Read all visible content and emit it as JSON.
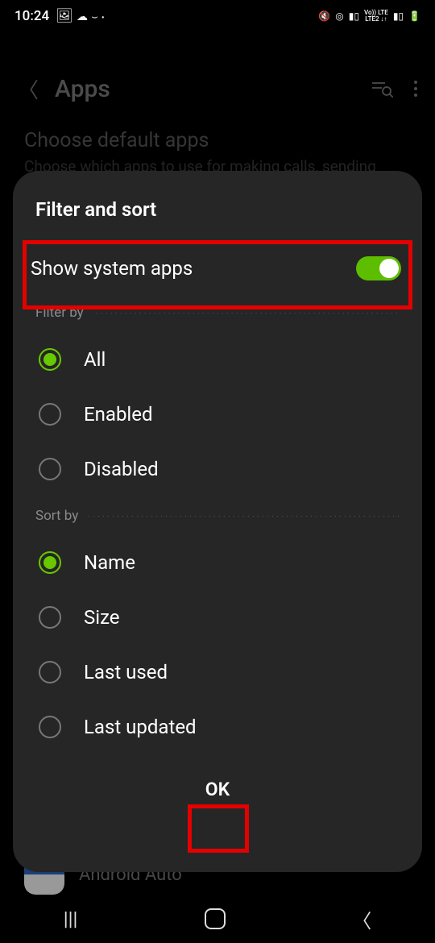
{
  "status": {
    "time": "10:24",
    "right_text": "LTE"
  },
  "bg": {
    "title": "Apps",
    "sub_title": "Choose default apps",
    "sub_text": "Choose which apps to use for making calls, sending",
    "app_name": "Android Auto"
  },
  "dialog": {
    "title": "Filter and sort",
    "toggle_label": "Show system apps",
    "filter_header": "Filter by",
    "filter_options": {
      "all": "All",
      "enabled": "Enabled",
      "disabled": "Disabled"
    },
    "sort_header": "Sort by",
    "sort_options": {
      "name": "Name",
      "size": "Size",
      "last_used": "Last used",
      "last_updated": "Last updated"
    },
    "ok": "OK"
  }
}
